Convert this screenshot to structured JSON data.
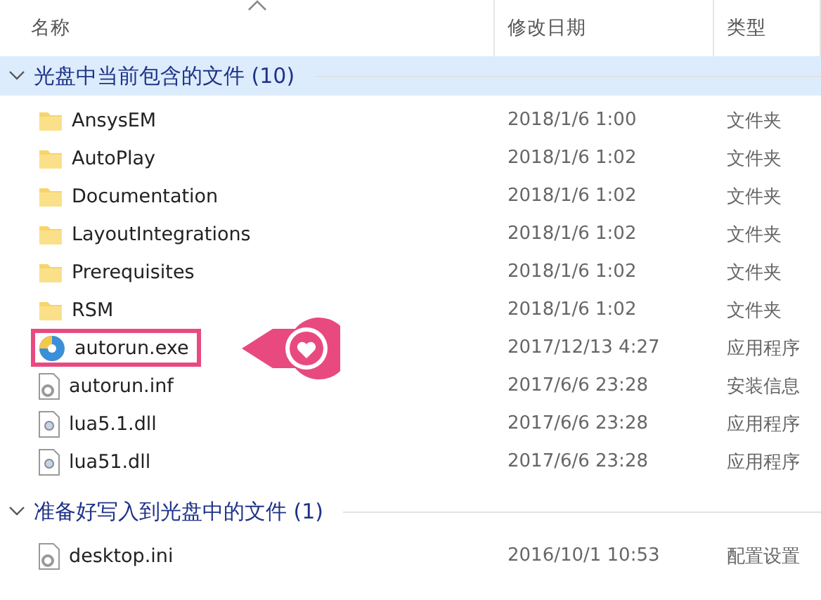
{
  "columns": [
    {
      "label": "名称",
      "sorted": true
    },
    {
      "label": "修改日期",
      "sorted": false
    },
    {
      "label": "类型",
      "sorted": false
    }
  ],
  "groups": [
    {
      "title": "光盘中当前包含的文件 (10)",
      "expanded": true,
      "items": [
        {
          "name": "AnsysEM",
          "date": "2018/1/6 1:00",
          "type": "文件夹",
          "kind": "folder",
          "highlighted": false
        },
        {
          "name": "AutoPlay",
          "date": "2018/1/6 1:02",
          "type": "文件夹",
          "kind": "folder",
          "highlighted": false
        },
        {
          "name": "Documentation",
          "date": "2018/1/6 1:02",
          "type": "文件夹",
          "kind": "folder",
          "highlighted": false
        },
        {
          "name": "LayoutIntegrations",
          "date": "2018/1/6 1:02",
          "type": "文件夹",
          "kind": "folder",
          "highlighted": false
        },
        {
          "name": "Prerequisites",
          "date": "2018/1/6 1:02",
          "type": "文件夹",
          "kind": "folder",
          "highlighted": false
        },
        {
          "name": "RSM",
          "date": "2018/1/6 1:02",
          "type": "文件夹",
          "kind": "folder",
          "highlighted": false
        },
        {
          "name": "autorun.exe",
          "date": "2017/12/13 4:27",
          "type": "应用程序",
          "kind": "exe",
          "highlighted": true
        },
        {
          "name": "autorun.inf",
          "date": "2017/6/6 23:28",
          "type": "安装信息",
          "kind": "settings",
          "highlighted": false
        },
        {
          "name": "lua5.1.dll",
          "date": "2017/6/6 23:28",
          "type": "应用程序",
          "kind": "library",
          "highlighted": false
        },
        {
          "name": "lua51.dll",
          "date": "2017/6/6 23:28",
          "type": "应用程序",
          "kind": "library",
          "highlighted": false
        }
      ]
    },
    {
      "title": "准备好写入到光盘中的文件 (1)",
      "expanded": true,
      "items": [
        {
          "name": "desktop.ini",
          "date": "2016/10/1 10:53",
          "type": "配置设置",
          "kind": "settings",
          "highlighted": false
        }
      ]
    }
  ]
}
